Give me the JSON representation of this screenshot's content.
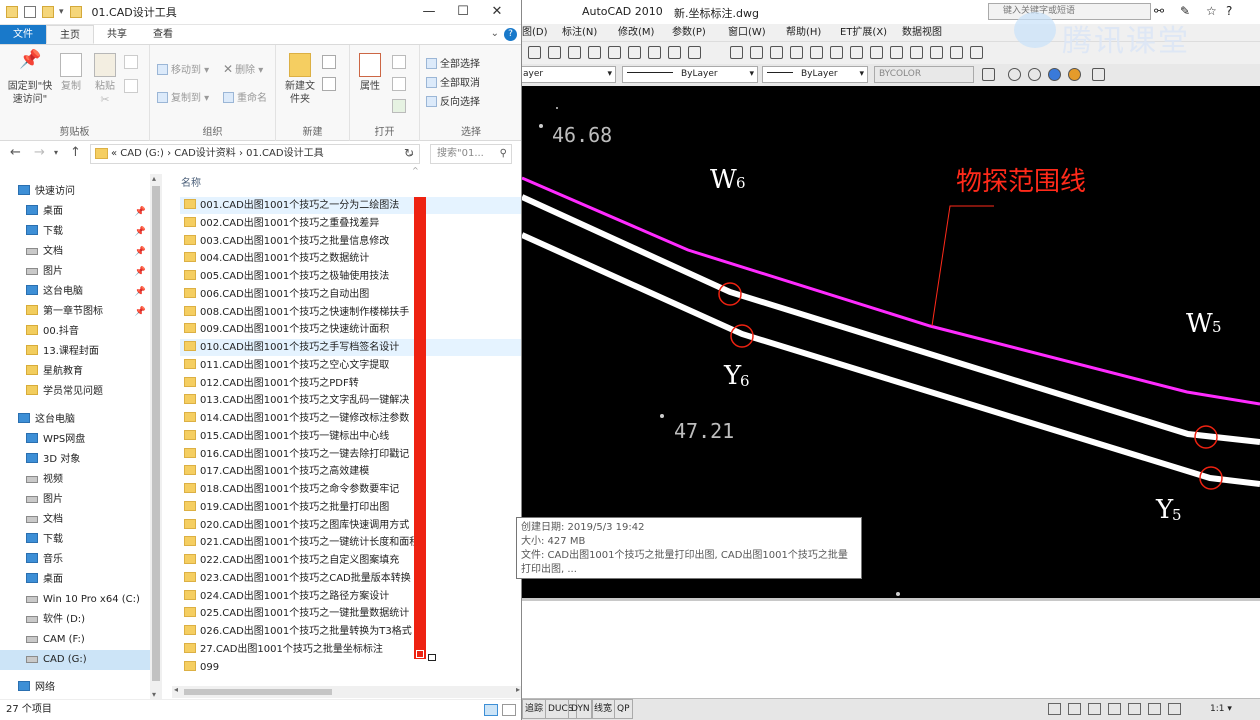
{
  "explorer": {
    "title": "01.CAD设计工具",
    "window_controls": {
      "minimize": "—",
      "maximize": "☐",
      "close": "✕"
    },
    "tabs": [
      "文件",
      "主页",
      "共享",
      "查看"
    ],
    "ribbon": {
      "clipboard": {
        "pin": "固定到\"快速访问\"",
        "copy": "复制",
        "paste": "粘贴",
        "group": "剪贴板"
      },
      "organize": {
        "move_to": "移动到 ▾",
        "copy_to": "复制到 ▾",
        "delete": "删除 ▾",
        "rename": "重命名",
        "group": "组织"
      },
      "new": {
        "new_folder": "新建文件夹",
        "group": "新建"
      },
      "open": {
        "properties": "属性",
        "group": "打开"
      },
      "select": {
        "select_all": "全部选择",
        "select_none": "全部取消",
        "invert": "反向选择",
        "group": "选择"
      }
    },
    "address": {
      "path": "« CAD (G:) › CAD设计资料 › 01.CAD设计工具",
      "search_placeholder": "搜索\"01...",
      "refresh": "↻"
    },
    "nav": {
      "back": "←",
      "forward": "→",
      "up": "↑"
    },
    "nav_items": [
      {
        "label": "快速访问",
        "pinned": false
      },
      {
        "label": "桌面",
        "pinned": true
      },
      {
        "label": "下载",
        "pinned": true
      },
      {
        "label": "文档",
        "pinned": true
      },
      {
        "label": "图片",
        "pinned": true
      },
      {
        "label": "这台电脑",
        "pinned": true
      },
      {
        "label": "第一章节图标",
        "pinned": true
      },
      {
        "label": "00.抖音",
        "pinned": false
      },
      {
        "label": "13.课程封面",
        "pinned": false
      },
      {
        "label": "星航教育",
        "pinned": false
      },
      {
        "label": "学员常见问题",
        "pinned": false
      },
      {
        "label": "这台电脑",
        "pinned": false
      },
      {
        "label": "WPS网盘",
        "pinned": false
      },
      {
        "label": "3D 对象",
        "pinned": false
      },
      {
        "label": "视频",
        "pinned": false
      },
      {
        "label": "图片",
        "pinned": false
      },
      {
        "label": "文档",
        "pinned": false
      },
      {
        "label": "下载",
        "pinned": false
      },
      {
        "label": "音乐",
        "pinned": false
      },
      {
        "label": "桌面",
        "pinned": false
      },
      {
        "label": "Win 10 Pro x64 (C:)",
        "pinned": false
      },
      {
        "label": "软件 (D:)",
        "pinned": false
      },
      {
        "label": "CAM (F:)",
        "pinned": false
      },
      {
        "label": "CAD (G:)",
        "pinned": false
      },
      {
        "label": "网络",
        "pinned": false
      }
    ],
    "column_header": "名称",
    "files": [
      "001.CAD出图1001个技巧之一分为二绘图法",
      "002.CAD出图1001个技巧之重叠找差异",
      "003.CAD出图1001个技巧之批量信息修改",
      "004.CAD出图1001个技巧之数据统计",
      "005.CAD出图1001个技巧之极轴使用技法",
      "006.CAD出图1001个技巧之自动出图",
      "008.CAD出图1001个技巧之快速制作楼梯扶手",
      "009.CAD出图1001个技巧之快速统计面积",
      "010.CAD出图1001个技巧之手写档签名设计",
      "011.CAD出图1001个技巧之空心文字提取",
      "012.CAD出图1001个技巧之PDF转",
      "013.CAD出图1001个技巧之文字乱码一键解决",
      "014.CAD出图1001个技巧之一键修改标注参数",
      "015.CAD出图1001个技巧一键标出中心线",
      "016.CAD出图1001个技巧之一键去除打印戳记",
      "017.CAD出图1001个技巧之高效建模",
      "018.CAD出图1001个技巧之命令参数要牢记",
      "019.CAD出图1001个技巧之批量打印出图",
      "020.CAD出图1001个技巧之图库快速调用方式",
      "021.CAD出图1001个技巧之一键统计长度和面积",
      "022.CAD出图1001个技巧之自定义图案填充",
      "023.CAD出图1001个技巧之CAD批量版本转换",
      "024.CAD出图1001个技巧之路径方案设计",
      "025.CAD出图1001个技巧之一键批量数据统计",
      "026.CAD出图1001个技巧之批量转换为T3格式",
      "27.CAD出图1001个技巧之批量坐标标注",
      "099"
    ],
    "tooltip": {
      "created": "创建日期: 2019/5/3 19:42",
      "size": "大小: 427 MB",
      "files": "文件: CAD出图1001个技巧之批量打印出图, CAD出图1001个技巧之批量打印出图, ..."
    },
    "status": "27 个项目"
  },
  "cad": {
    "app_title": "AutoCAD 2010",
    "doc_title": "新.坐标标注.dwg",
    "search_placeholder": "键入关键字或短语",
    "watermark": "腾讯课堂",
    "menu": [
      "图(D)",
      "标注(N)",
      "修改(M)",
      "参数(P)",
      "窗口(W)",
      "帮助(H)",
      "ET扩展(X)",
      "数据视图"
    ],
    "layer_combo": "ayer",
    "linetype": "ByLayer",
    "lineweight": "ByLayer",
    "color": "BYCOLOR",
    "drawing": {
      "elev_1": "46.68",
      "elev_2": "47.21",
      "annotation": "物探范围线",
      "w6": "W",
      "w6_sub": "6",
      "w5": "W",
      "w5_sub": "5",
      "y6": "Y",
      "y6_sub": "6",
      "y5": "Y",
      "y5_sub": "5"
    },
    "status_left": [
      "追踪",
      "DUCS",
      "DYN",
      "线宽",
      "QP"
    ],
    "status_scale": "1:1 ▾"
  },
  "colors": {
    "boundary": "#ff2bff",
    "annotation": "#ff2a1a",
    "red_marker": "#ee2211",
    "file_tab": "#1979ca"
  }
}
